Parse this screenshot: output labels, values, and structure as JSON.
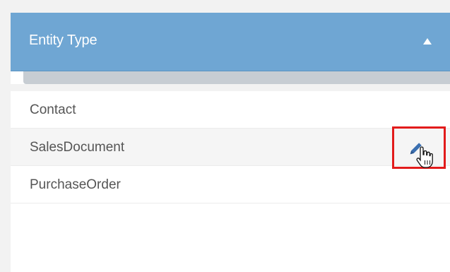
{
  "panel": {
    "title": "Entity Type",
    "collapse_icon": "caret-up-icon"
  },
  "entity_types": [
    {
      "label": "Contact"
    },
    {
      "label": "SalesDocument"
    },
    {
      "label": "PurchaseOrder"
    }
  ],
  "row_action": {
    "icon": "pencil-icon",
    "highlight_color": "#e21b1b"
  },
  "colors": {
    "header": "#6fa6d3",
    "row_text": "#555555",
    "pencil": "#3b6fb0"
  }
}
